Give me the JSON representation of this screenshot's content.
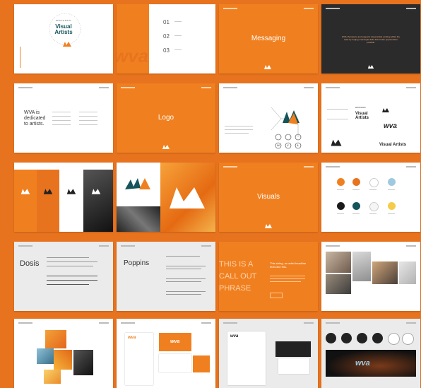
{
  "colors": {
    "page_background": "#e8731f",
    "brand_orange": "#f0801f",
    "dark_teal": "#15545a",
    "charcoal": "#2b2b2b",
    "light_gray": "#ebebeb",
    "swatch_blue": "#9ec9df",
    "swatch_yellow": "#f4cc4a"
  },
  "cover": {
    "brand_top": "WISCONSIN",
    "brand_title": "Visual Artists"
  },
  "toc": {
    "numbers": [
      "01",
      "02",
      "03"
    ],
    "monogram": "wva"
  },
  "section_titles": {
    "messaging": "Messaging",
    "logo": "Logo",
    "visuals": "Visuals"
  },
  "mission": {
    "text": "WVA champions and supports visual artists working within the state by forging meaningful links that create opportunities possible."
  },
  "dedicated": {
    "heading": "WVA is dedicated to artists."
  },
  "logo_variants": {
    "brand_top": "WISCONSIN",
    "brand_title": "Visual Artists",
    "monogram": "wva",
    "circle_letters": [
      "W",
      "V",
      "A"
    ]
  },
  "typography": {
    "dosis_title": "Dosis",
    "poppins_title": "Poppins"
  },
  "callout": {
    "text": "THIS IS A CALL OUT PHRASE",
    "orange_note": "This string, an artist headline feels like this."
  },
  "monograms": {
    "wva": "wva"
  },
  "icons": [
    "wva-hand-mark-icon",
    "circle-badge-icon"
  ]
}
